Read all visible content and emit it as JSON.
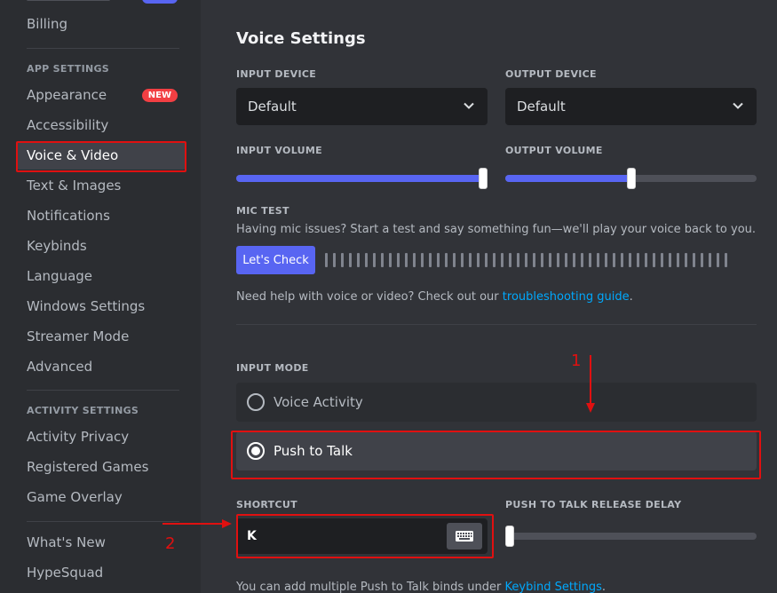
{
  "sidebar": {
    "top_item": "Billing",
    "app_settings_header": "APP SETTINGS",
    "app_items": [
      {
        "label": "Appearance",
        "badge": "NEW"
      },
      {
        "label": "Accessibility"
      },
      {
        "label": "Voice & Video",
        "active": true
      },
      {
        "label": "Text & Images"
      },
      {
        "label": "Notifications"
      },
      {
        "label": "Keybinds"
      },
      {
        "label": "Language"
      },
      {
        "label": "Windows Settings"
      },
      {
        "label": "Streamer Mode"
      },
      {
        "label": "Advanced"
      }
    ],
    "activity_settings_header": "ACTIVITY SETTINGS",
    "activity_items": [
      {
        "label": "Activity Privacy"
      },
      {
        "label": "Registered Games"
      },
      {
        "label": "Game Overlay"
      }
    ],
    "bottom_items": [
      {
        "label": "What's New"
      },
      {
        "label": "HypeSquad"
      }
    ]
  },
  "main": {
    "title": "Voice Settings",
    "input_device": {
      "label": "INPUT DEVICE",
      "value": "Default"
    },
    "output_device": {
      "label": "OUTPUT DEVICE",
      "value": "Default"
    },
    "input_volume": {
      "label": "INPUT VOLUME",
      "level": 1.0
    },
    "output_volume": {
      "label": "OUTPUT VOLUME",
      "level": 0.5
    },
    "mic_test": {
      "label": "MIC TEST",
      "description": "Having mic issues? Start a test and say something fun—we'll play your voice back to you.",
      "button": "Let's Check"
    },
    "help": {
      "prefix": "Need help with voice or video? Check out our ",
      "link": "troubleshooting guide",
      "suffix": "."
    },
    "input_mode": {
      "label": "INPUT MODE",
      "options": [
        {
          "label": "Voice Activity",
          "selected": false
        },
        {
          "label": "Push to Talk",
          "selected": true
        }
      ]
    },
    "shortcut": {
      "label": "SHORTCUT",
      "value": "K"
    },
    "release_delay": {
      "label": "PUSH TO TALK RELEASE DELAY",
      "level": 0.0
    },
    "footer": {
      "prefix": "You can add multiple Push to Talk binds under ",
      "link": "Keybind Settings",
      "suffix": "."
    }
  },
  "annotations": {
    "marker_1": "1",
    "marker_2": "2",
    "color": "#e01010"
  },
  "colors": {
    "accent": "#5865f2",
    "link": "#00a8fc",
    "badge": "#f23f43",
    "background": "#313338",
    "sidebar": "#2b2d31"
  }
}
